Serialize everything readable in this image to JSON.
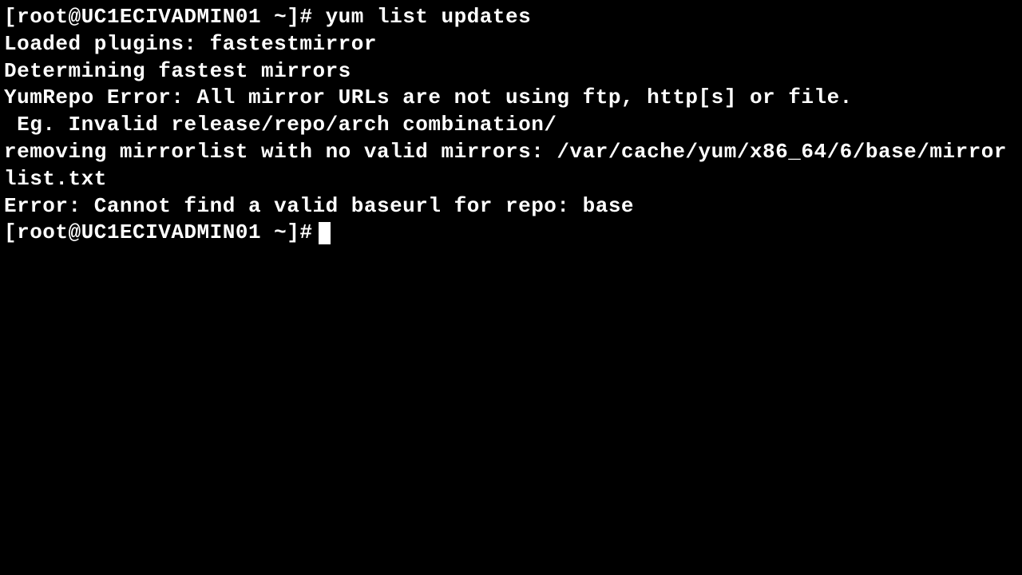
{
  "terminal": {
    "prompt1": "[root@UC1ECIVADMIN01 ~]# ",
    "command": "yum list updates",
    "lines": {
      "l1": "Loaded plugins: fastestmirror",
      "l2": "Determining fastest mirrors",
      "l3": "YumRepo Error: All mirror URLs are not using ftp, http[s] or file.",
      "l4": " Eg. Invalid release/repo/arch combination/",
      "l5": "removing mirrorlist with no valid mirrors: /var/cache/yum/x86_64/6/base/mirrorlist.txt",
      "l6": "Error: Cannot find a valid baseurl for repo: base"
    },
    "prompt2": "[root@UC1ECIVADMIN01 ~]# "
  }
}
